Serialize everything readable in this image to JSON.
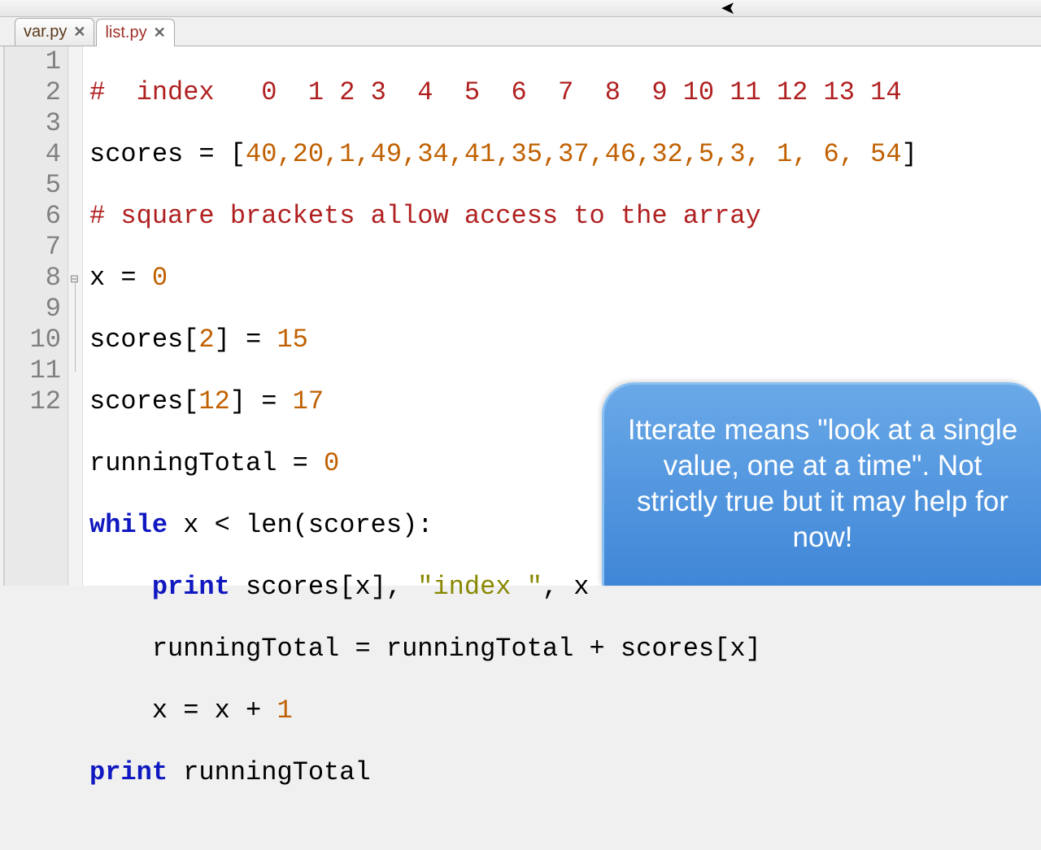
{
  "tabs": [
    {
      "label": "var.py",
      "active": false
    },
    {
      "label": "list.py",
      "active": true
    }
  ],
  "line_numbers": [
    "1",
    "2",
    "3",
    "4",
    "5",
    "6",
    "7",
    "8",
    "9",
    "10",
    "11",
    "12"
  ],
  "code": {
    "l1": {
      "comment": "#  index   0  1 2 3  4  5  6  7  8  9 10 11 12 13 14"
    },
    "l2": {
      "ident": "scores",
      "eq": " = ",
      "lb": "[",
      "nums": "40,20,1,49,34,41,35,37,46,32,5,3, 1, 6, 54",
      "rb": "]"
    },
    "l3": {
      "comment": "# square brackets allow access to the array"
    },
    "l4": {
      "ident": "x",
      "eq": " = ",
      "num": "0"
    },
    "l5": {
      "ident": "scores",
      "lb": "[",
      "idx": "2",
      "rb": "]",
      "eq": " = ",
      "val": "15"
    },
    "l6": {
      "ident": "scores",
      "lb": "[",
      "idx": "12",
      "rb": "]",
      "eq": " = ",
      "val": "17"
    },
    "l7": {
      "ident": "runningTotal",
      "eq": " = ",
      "num": "0"
    },
    "l8": {
      "kw": "while",
      "sp": " ",
      "id1": "x",
      "op": " < ",
      "fn": "len",
      "lp": "(",
      "arg": "scores",
      "rp": ")",
      "colon": ":"
    },
    "l9": {
      "indent": "    ",
      "kw": "print",
      "sp": " ",
      "id": "scores",
      "lb": "[",
      "idx": "x",
      "rb": "]",
      "c1": ", ",
      "str": "\"index \"",
      "c2": ", ",
      "x": "x"
    },
    "l10": {
      "indent": "    ",
      "id": "runningTotal",
      "eq": " = ",
      "id2": "runningTotal",
      "op": " + ",
      "id3": "scores",
      "lb": "[",
      "idx": "x",
      "rb": "]"
    },
    "l11": {
      "indent": "    ",
      "id": "x",
      "eq": " = ",
      "id2": "x",
      "op": " + ",
      "num": "1"
    },
    "l12": {
      "kw": "print",
      "sp": " ",
      "id": "runningTotal"
    }
  },
  "callout_text": "Itterate means \"look at a single value, one at a time\". Not strictly true but it may help for now!"
}
